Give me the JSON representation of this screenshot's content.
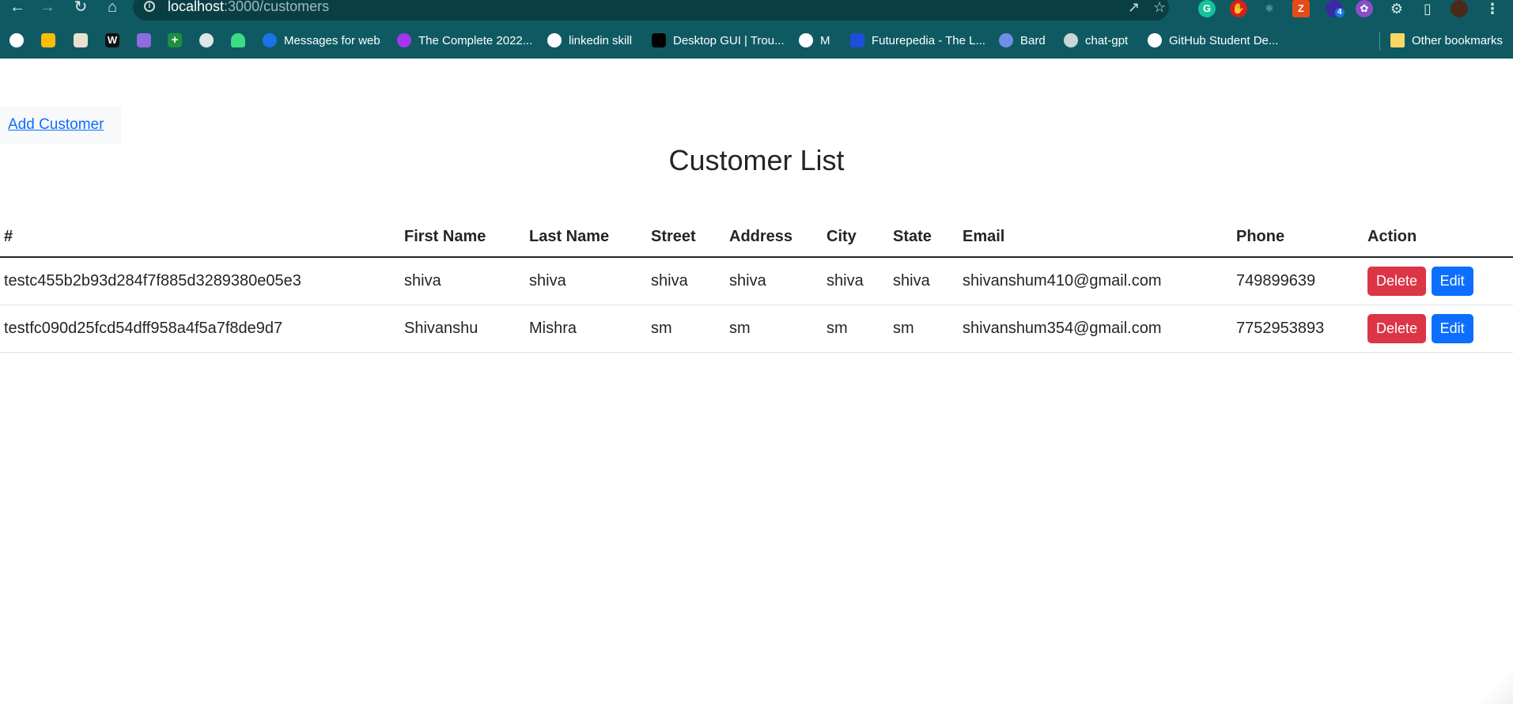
{
  "browser": {
    "url_host": "localhost",
    "url_path": ":3000/customers",
    "accent": "#0f5a62",
    "extension_badge": "4",
    "bookmarks": [
      {
        "label": "",
        "icon": "google-icon"
      },
      {
        "label": "",
        "icon": "google-ads-icon"
      },
      {
        "label": "",
        "icon": "bookmark-image-icon"
      },
      {
        "label": "",
        "icon": "w-icon"
      },
      {
        "label": "",
        "icon": "colorful-icon"
      },
      {
        "label": "",
        "icon": "plus-icon"
      },
      {
        "label": "",
        "icon": "globe-icon"
      },
      {
        "label": "",
        "icon": "android-icon"
      },
      {
        "label": "Messages for web",
        "icon": "messages-icon"
      },
      {
        "label": "The Complete 2022...",
        "icon": "udemy-icon"
      },
      {
        "label": "linkedin skill",
        "icon": "github-icon"
      },
      {
        "label": "Desktop GUI | Trou...",
        "icon": "bookmark-icon"
      },
      {
        "label": "M",
        "icon": "github-icon"
      },
      {
        "label": "Futurepedia - The L...",
        "icon": "futurepedia-icon"
      },
      {
        "label": "Bard",
        "icon": "bard-icon"
      },
      {
        "label": "chat-gpt",
        "icon": "chatgpt-icon"
      },
      {
        "label": "GitHub Student De...",
        "icon": "github-icon"
      }
    ],
    "other_bookmarks": "Other bookmarks"
  },
  "page": {
    "add_customer": "Add Customer",
    "title": "Customer List"
  },
  "table": {
    "headers": [
      "#",
      "First Name",
      "Last Name",
      "Street",
      "Address",
      "City",
      "State",
      "Email",
      "Phone",
      "Action"
    ],
    "rows": [
      [
        "testc455b2b93d284f7f885d3289380e05e3",
        "shiva",
        "shiva",
        "shiva",
        "shiva",
        "shiva",
        "shiva",
        "shivanshum410@gmail.com",
        "749899639"
      ],
      [
        "testfc090d25fcd54dff958a4f5a7f8de9d7",
        "Shivanshu",
        "Mishra",
        "sm",
        "sm",
        "sm",
        "sm",
        "shivanshum354@gmail.com",
        "7752953893"
      ]
    ],
    "delete_label": "Delete",
    "edit_label": "Edit",
    "danger_color": "#dc3545",
    "primary_color": "#0d6efd"
  }
}
